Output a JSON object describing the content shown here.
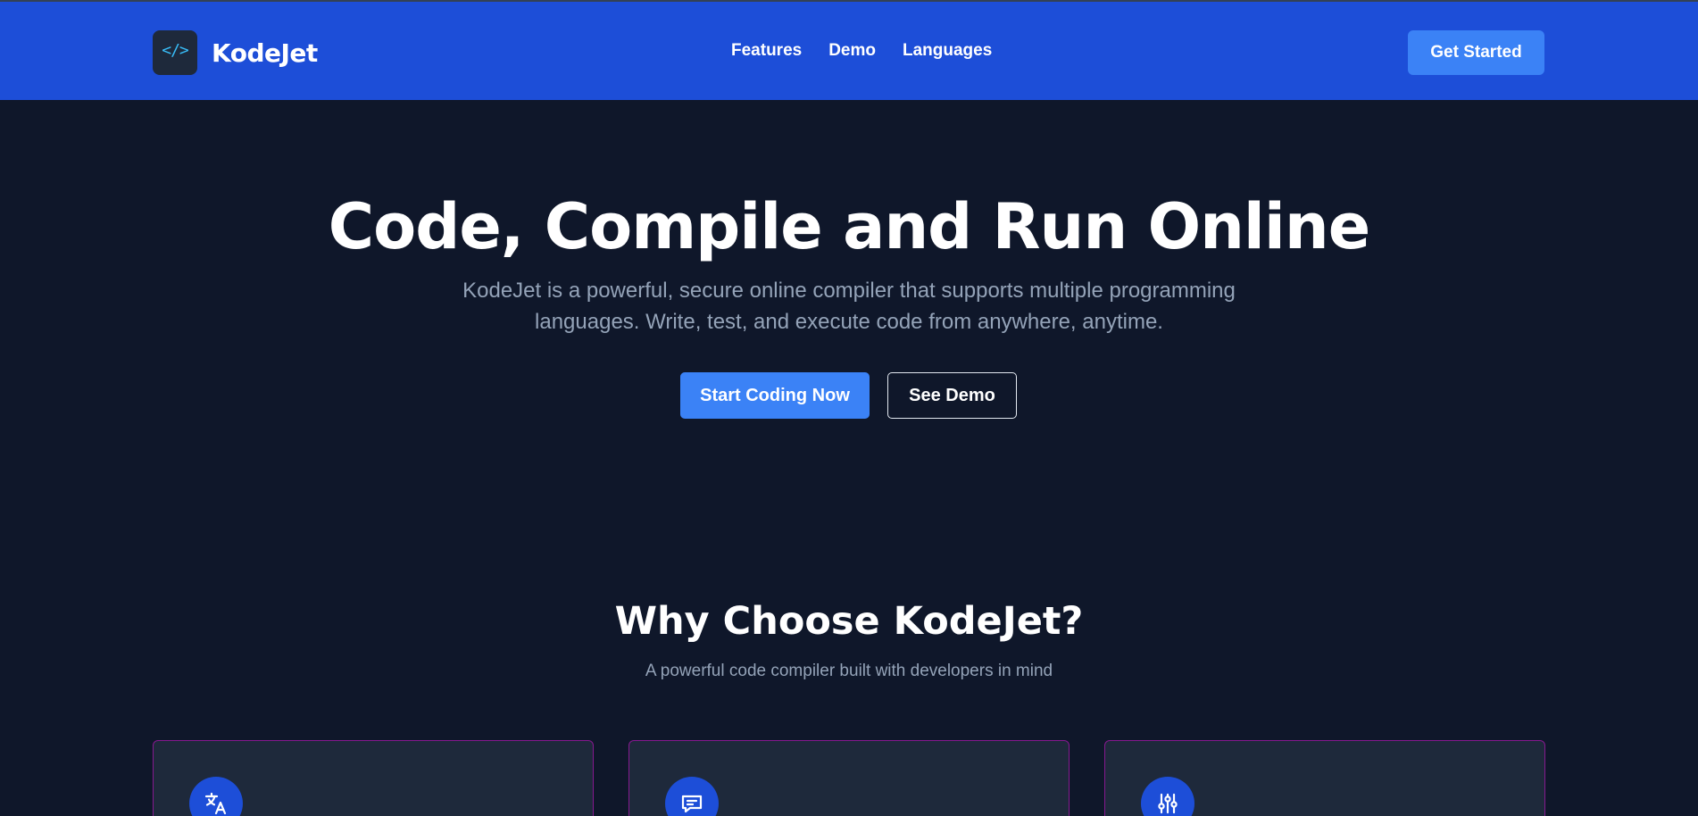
{
  "header": {
    "brand": {
      "logo_glyph": "</>",
      "name": "KodeJet"
    },
    "nav": [
      {
        "label": "Features"
      },
      {
        "label": "Demo"
      },
      {
        "label": "Languages"
      }
    ],
    "cta_label": "Get Started"
  },
  "hero": {
    "title": "Code, Compile and Run Online",
    "subtitle": "KodeJet is a powerful, secure online compiler that supports multiple programming languages. Write, test, and execute code from anywhere, anytime.",
    "primary_label": "Start Coding Now",
    "secondary_label": "See Demo"
  },
  "features": {
    "title": "Why Choose KodeJet?",
    "subtitle": "A powerful code compiler built with developers in mind",
    "cards": [
      {
        "icon": "translate-icon"
      },
      {
        "icon": "message-icon"
      },
      {
        "icon": "sliders-icon"
      }
    ]
  },
  "colors": {
    "header_bg": "#1d4ed8",
    "page_bg": "#0f172a",
    "accent": "#3b82f6",
    "card_bg": "#1e293b",
    "card_border": "#86198f",
    "muted_text": "#94a3b8"
  }
}
